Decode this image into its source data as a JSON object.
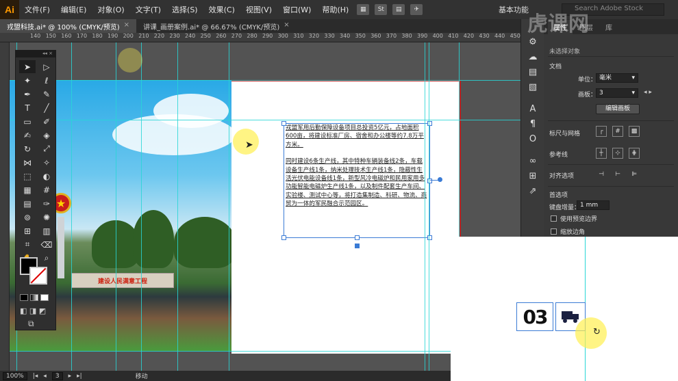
{
  "app": {
    "logo": "Ai",
    "menu": [
      "文件(F)",
      "编辑(E)",
      "对象(O)",
      "文字(T)",
      "选择(S)",
      "效果(C)",
      "视图(V)",
      "窗口(W)",
      "帮助(H)"
    ],
    "workspace": "基本功能",
    "search_placeholder": "Search Adobe Stock"
  },
  "doc_tabs": [
    {
      "label": "戎盟科技.ai* @ 100% (CMYK/预览)",
      "active": true
    },
    {
      "label": "讲课_画册案例.ai* @ 66.67% (CMYK/预览)",
      "active": false
    }
  ],
  "ruler": {
    "ticks": [
      "140",
      "150",
      "160",
      "170",
      "180",
      "190",
      "200",
      "210",
      "220",
      "230",
      "240",
      "250",
      "260",
      "270",
      "280",
      "290",
      "300",
      "310",
      "320",
      "330",
      "340",
      "350",
      "360",
      "370",
      "380",
      "390",
      "400",
      "410",
      "420",
      "430",
      "440",
      "450"
    ]
  },
  "tools_panel": {
    "collapse": "◂◂ ×",
    "tools": [
      "selection-tool",
      "direct-selection-tool",
      "magic-wand-tool",
      "lasso-tool",
      "pen-tool",
      "curvature-tool",
      "type-tool",
      "line-tool",
      "rectangle-tool",
      "paintbrush-tool",
      "shaper-tool",
      "eraser-tool",
      "rotate-tool",
      "scale-tool",
      "width-tool",
      "puppet-warp-tool",
      "free-transform-tool",
      "shape-builder-tool",
      "perspective-grid-tool",
      "mesh-tool",
      "gradient-tool",
      "eyedropper-tool",
      "blend-tool",
      "symbol-sprayer-tool",
      "artboard-tool",
      "column-graph-tool",
      "slice-tool",
      "zoom-tool",
      "hand-tool",
      "zoom-tool-2"
    ]
  },
  "text_frame": {
    "para1": "戎盟军用后勤保障设备项目总投资5亿元，占地面积600亩，将建设标准厂房、宿舍和办公楼等约7.8万平方米。",
    "para2": "同时建设6条生产线，其中特种车辆装备线2条，车载设备生产线1条，纳米处理技术生产线1条，隐蔽性生活光伏电能设备线1条，新型风冷电磁炉和民用家用多功能智能电磁炉生产线1条，以及制件配套生产车间、实验楼、测试中心等，将打造集制造、科研、物流、商贸为一体的军民融合示范园区。"
  },
  "photo": {
    "slogan": "建设人民满意工程"
  },
  "properties": {
    "tabs": [
      "属性",
      "图层",
      "库"
    ],
    "no_selection": "未选择对象",
    "document_label": "文档",
    "units_label": "单位：",
    "units_value": "毫米",
    "artboard_label": "画板：",
    "artboard_value": "3",
    "edit_artboard_button": "编辑画板",
    "rulers_grid_label": "标尺与网格",
    "guides_label": "参考线",
    "align_label": "对齐选项",
    "preferences_label": "首选项",
    "keyboard_increment_label": "键盘增量：",
    "keyboard_increment_value": "1 mm",
    "preview_bounds_label": "使用预览边界",
    "scale_corners_label": "缩放边角"
  },
  "overlay": {
    "logo_text": "03"
  },
  "status": {
    "zoom": "100%",
    "page": "3",
    "tool": "移动"
  },
  "watermark": "虎课网"
}
